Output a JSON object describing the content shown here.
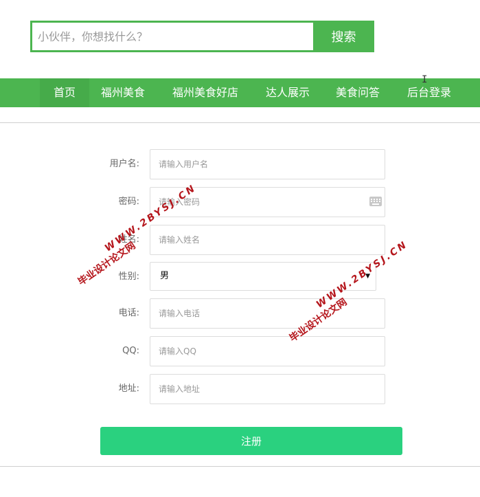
{
  "search": {
    "placeholder": "小伙伴，你想找什么？",
    "button_label": "搜索"
  },
  "nav": {
    "items": [
      {
        "label": "首页",
        "active": true
      },
      {
        "label": "福州美食"
      },
      {
        "label": "福州美食好店"
      },
      {
        "label": "达人展示"
      },
      {
        "label": "美食问答"
      },
      {
        "label": "后台登录"
      }
    ]
  },
  "form": {
    "username": {
      "label": "用户名:",
      "placeholder": "请输入用户名"
    },
    "password": {
      "label": "密码:",
      "placeholder": "请输入密码",
      "icon": "keyboard-icon"
    },
    "name": {
      "label": "姓名:",
      "placeholder": "请输入姓名"
    },
    "gender": {
      "label": "性别:",
      "value": "男"
    },
    "phone": {
      "label": "电话:",
      "placeholder": "请输入电话"
    },
    "qq": {
      "label": "QQ:",
      "placeholder": "请输入QQ"
    },
    "address": {
      "label": "地址:",
      "placeholder": "请输入地址"
    },
    "submit_label": "注册"
  },
  "watermarks": [
    {
      "title": "毕业设计论文网",
      "url": "WWW.2BYSJ.CN"
    },
    {
      "title": "毕业设计论文网",
      "url": "WWW.2BYSJ.CN"
    }
  ],
  "colors": {
    "primary_green": "#4cb550",
    "submit_green": "#2ad17f",
    "watermark_red": "#b5161c"
  }
}
